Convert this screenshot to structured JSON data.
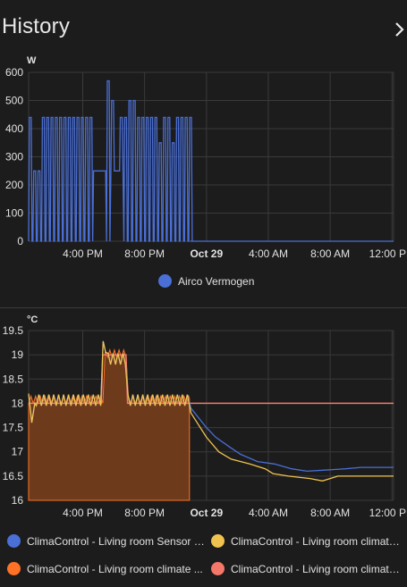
{
  "header": {
    "title": "History"
  },
  "chart_data": [
    {
      "type": "line",
      "ylabel": "W",
      "ylim": [
        0,
        600
      ],
      "yticks": [
        "600",
        "500",
        "400",
        "300",
        "200",
        "100",
        "0"
      ],
      "xticks": [
        "4:00 PM",
        "8:00 PM",
        "Oct 29",
        "4:00 AM",
        "8:00 AM",
        "12:00 PM"
      ],
      "series": [
        {
          "name": "Airco Vermogen",
          "color": "#4a6fd6",
          "description": "cycling between ~0 and ~440 W from ~1:30 PM to ~10:30 PM, peaks ~500-570 W, then 0",
          "points": [
            [
              12.5,
              250
            ],
            [
              13.4,
              0
            ],
            [
              13.6,
              500
            ],
            [
              14.0,
              450
            ],
            [
              14.2,
              0
            ],
            [
              14.6,
              440
            ],
            [
              15.5,
              0
            ],
            [
              16.0,
              440
            ],
            [
              16.8,
              250
            ],
            [
              17.0,
              440
            ],
            [
              17.5,
              570
            ],
            [
              17.8,
              250
            ],
            [
              18.2,
              500
            ],
            [
              18.6,
              250
            ],
            [
              19.0,
              500
            ],
            [
              19.6,
              440
            ],
            [
              20.0,
              0
            ],
            [
              20.6,
              440
            ],
            [
              21.0,
              350
            ],
            [
              21.5,
              440
            ],
            [
              22.0,
              0
            ],
            [
              22.5,
              440
            ],
            [
              22.9,
              0
            ],
            [
              36.2,
              0
            ]
          ]
        }
      ]
    },
    {
      "type": "line",
      "ylabel": "°C",
      "ylim": [
        16,
        19.5
      ],
      "yticks": [
        "19.5",
        "19",
        "18.5",
        "18",
        "17.5",
        "17",
        "16.5",
        "16"
      ],
      "xticks": [
        "4:00 PM",
        "8:00 PM",
        "Oct 29",
        "4:00 AM",
        "8:00 AM",
        "12:00 PM"
      ],
      "series": [
        {
          "name": "ClimaControl - Living room Sensor -...",
          "color": "#4a6fd6"
        },
        {
          "name": "ClimaControl - Living room climate ...",
          "color": "#f0c350"
        },
        {
          "name": "ClimaControl - Living room climate ...",
          "color": "#ff7226",
          "fill_color": "#6e3a1c"
        },
        {
          "name": "ClimaControl - Living room climate ...",
          "color": "#f4786a"
        }
      ]
    }
  ],
  "legend_top": [
    {
      "label": "Airco Vermogen",
      "color": "#4a6fd6"
    }
  ],
  "legend_bottom": [
    {
      "label": "ClimaControl - Living room Sensor -...",
      "color": "#4a6fd6"
    },
    {
      "label": "ClimaControl - Living room climate ...",
      "color": "#f0c350"
    },
    {
      "label": "ClimaControl - Living room climate ...",
      "color": "#ff7226"
    },
    {
      "label": "ClimaControl - Living room climate ...",
      "color": "#f4786a"
    }
  ]
}
